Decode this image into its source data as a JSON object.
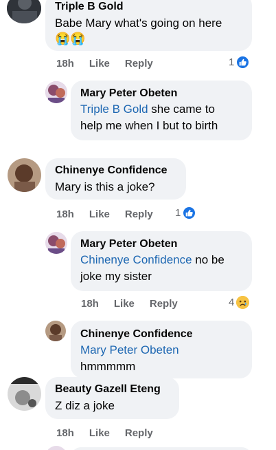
{
  "comments": [
    {
      "author": "Triple B Gold",
      "text": "Babe Mary what's going on here",
      "emoji": "😭😭",
      "time": "18h",
      "like_label": "Like",
      "reply_label": "Reply",
      "reaction_count": "1",
      "reaction": "like",
      "replies": [
        {
          "author": "Mary Peter Obeten",
          "mention": "Triple B Gold",
          "text_line1_rest": " she came to",
          "text_line2": "help me when I but to birth"
        }
      ]
    },
    {
      "author": "Chinenye Confidence",
      "text": "Mary is this a joke?",
      "time": "18h",
      "like_label": "Like",
      "reply_label": "Reply",
      "reaction_count": "1",
      "reaction": "like",
      "replies": [
        {
          "author": "Mary Peter Obeten",
          "mention": "Chinenye Confidence",
          "text_line1_rest": " no be",
          "text_line2": "joke my sister",
          "time": "18h",
          "like_label": "Like",
          "reply_label": "Reply",
          "reaction_count": "4",
          "reaction": "sad"
        },
        {
          "author": "Chinenye Confidence",
          "mention": "Mary Peter Obeten",
          "text_line2": "hmmmmm"
        }
      ]
    },
    {
      "author": "Beauty Gazell Eteng",
      "text": "Z diz a joke",
      "time": "18h",
      "like_label": "Like",
      "reply_label": "Reply"
    }
  ],
  "colors": {
    "bubble_bg": "#f0f2f5",
    "mention": "#1d67b2",
    "meta": "#65676b",
    "like_blue": "#1b74e4"
  }
}
